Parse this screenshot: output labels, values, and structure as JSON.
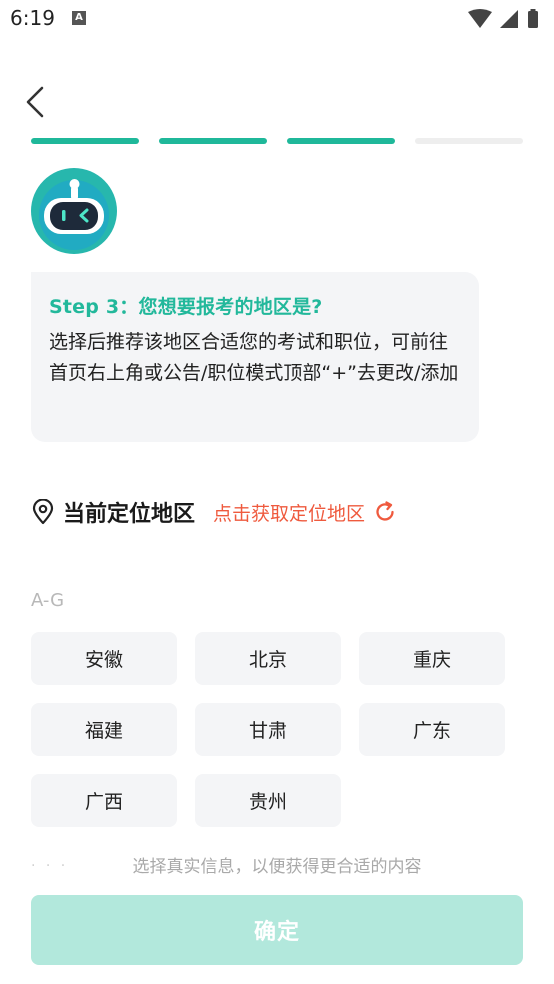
{
  "status_bar": {
    "time": "6:19",
    "notification_letter": "A"
  },
  "progress": {
    "total_steps": 4,
    "completed_steps": 3
  },
  "bubble": {
    "title": "Step 3：您想要报考的地区是?",
    "description": "选择后推荐该地区合适您的考试和职位，可前往首页右上角或公告/职位模式顶部“+”去更改/添加"
  },
  "location": {
    "title": "当前定位地区",
    "action": "点击获取定位地区"
  },
  "region_group": {
    "label": "A-G",
    "regions": [
      "安徽",
      "北京",
      "重庆",
      "福建",
      "甘肃",
      "广东",
      "广西",
      "贵州"
    ]
  },
  "hint": "选择真实信息，以便获得更合适的内容",
  "confirm_label": "确定",
  "colors": {
    "accent": "#1fb89a",
    "action": "#ef5a3e",
    "confirm_disabled": "#b2e8dc"
  }
}
